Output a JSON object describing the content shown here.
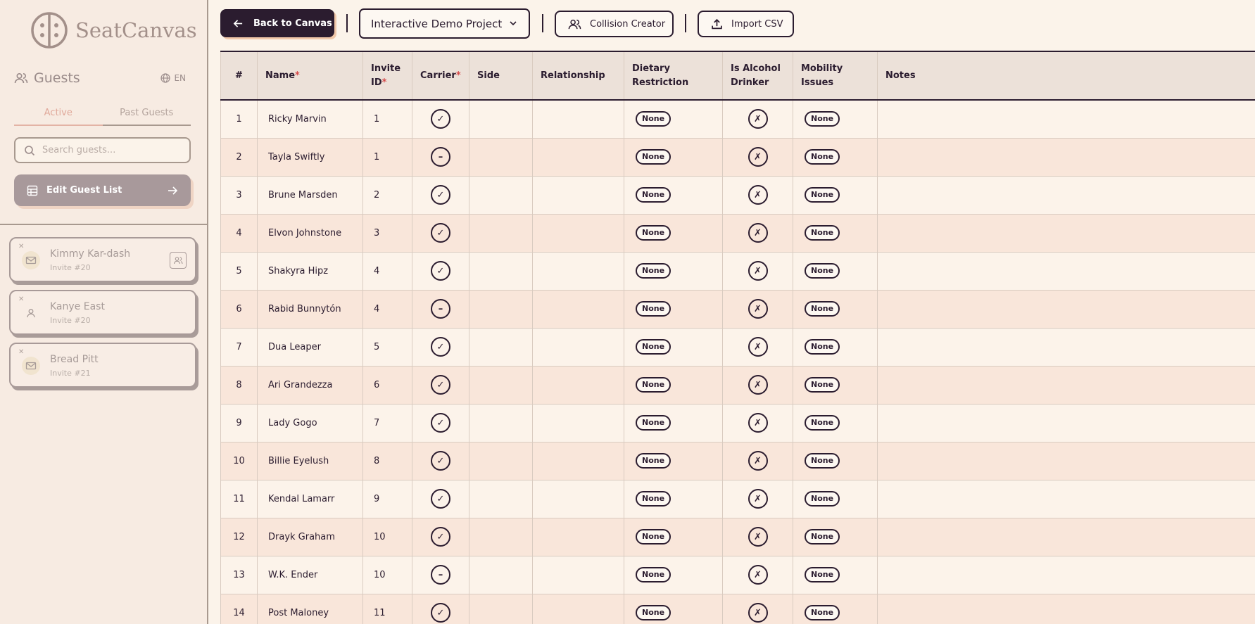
{
  "app": {
    "logo_text": "SeatCanvas"
  },
  "sidebar": {
    "title": "Guests",
    "language": "EN",
    "tabs": [
      {
        "label": "Active",
        "active": true
      },
      {
        "label": "Past Guests",
        "active": false
      }
    ],
    "search_placeholder": "Search guests...",
    "edit_button_label": "Edit Guest List",
    "guests": [
      {
        "name": "Kimmy Kar-dash",
        "invite": "Invite #20",
        "icon": "mail-icon"
      },
      {
        "name": "Kanye East",
        "invite": "Invite #20",
        "icon": "person-icon"
      },
      {
        "name": "Bread Pitt",
        "invite": "Invite #21",
        "icon": "mail-icon"
      }
    ]
  },
  "toolbar": {
    "back_label": "Back to Canvas",
    "project_label": "Interactive Demo Project",
    "collision_label": "Collision Creator",
    "import_label": "Import CSV"
  },
  "table": {
    "columns": {
      "num": "#",
      "name": "Name",
      "invite_a": "Invite",
      "invite_b": "ID",
      "carrier": "Carrier",
      "side": "Side",
      "relationship": "Relationship",
      "dietary_a": "Dietary",
      "dietary_b": "Restriction",
      "alcohol_a": "Is Alcohol",
      "alcohol_b": "Drinker",
      "mobility": "Mobility Issues",
      "notes": "Notes",
      "required_mark": "*"
    },
    "rows": [
      {
        "num": "1",
        "name": "Ricky Marvin",
        "invite": "1",
        "carrier": "check",
        "dietary": "None",
        "alcohol": "cross",
        "mobility": "None"
      },
      {
        "num": "2",
        "name": "Tayla Swiftly",
        "invite": "1",
        "carrier": "dash",
        "dietary": "None",
        "alcohol": "cross",
        "mobility": "None"
      },
      {
        "num": "3",
        "name": "Brune Marsden",
        "invite": "2",
        "carrier": "check",
        "dietary": "None",
        "alcohol": "cross",
        "mobility": "None"
      },
      {
        "num": "4",
        "name": "Elvon Johnstone",
        "invite": "3",
        "carrier": "check",
        "dietary": "None",
        "alcohol": "cross",
        "mobility": "None"
      },
      {
        "num": "5",
        "name": "Shakyra Hipz",
        "invite": "4",
        "carrier": "check",
        "dietary": "None",
        "alcohol": "cross",
        "mobility": "None"
      },
      {
        "num": "6",
        "name": "Rabid Bunnytón",
        "invite": "4",
        "carrier": "dash",
        "dietary": "None",
        "alcohol": "cross",
        "mobility": "None"
      },
      {
        "num": "7",
        "name": "Dua Leaper",
        "invite": "5",
        "carrier": "check",
        "dietary": "None",
        "alcohol": "cross",
        "mobility": "None"
      },
      {
        "num": "8",
        "name": "Ari Grandezza",
        "invite": "6",
        "carrier": "check",
        "dietary": "None",
        "alcohol": "cross",
        "mobility": "None"
      },
      {
        "num": "9",
        "name": "Lady Gogo",
        "invite": "7",
        "carrier": "check",
        "dietary": "None",
        "alcohol": "cross",
        "mobility": "None"
      },
      {
        "num": "10",
        "name": "Billie Eyelush",
        "invite": "8",
        "carrier": "check",
        "dietary": "None",
        "alcohol": "cross",
        "mobility": "None"
      },
      {
        "num": "11",
        "name": "Kendal Lamarr",
        "invite": "9",
        "carrier": "check",
        "dietary": "None",
        "alcohol": "cross",
        "mobility": "None"
      },
      {
        "num": "12",
        "name": "Drayk Graham",
        "invite": "10",
        "carrier": "check",
        "dietary": "None",
        "alcohol": "cross",
        "mobility": "None"
      },
      {
        "num": "13",
        "name": "W.K. Ender",
        "invite": "10",
        "carrier": "dash",
        "dietary": "None",
        "alcohol": "cross",
        "mobility": "None"
      },
      {
        "num": "14",
        "name": "Post Maloney",
        "invite": "11",
        "carrier": "check",
        "dietary": "None",
        "alcohol": "cross",
        "mobility": "None"
      }
    ],
    "glyphs": {
      "check": "✓",
      "dash": "–",
      "cross": "✗"
    }
  }
}
